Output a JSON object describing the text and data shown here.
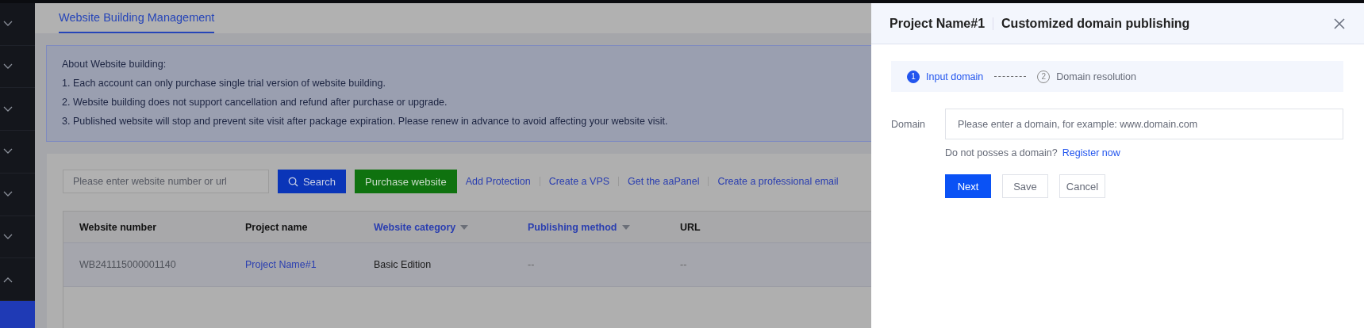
{
  "sidebar": {
    "items": [
      {
        "expanded": false
      },
      {
        "expanded": false
      },
      {
        "expanded": false
      },
      {
        "expanded": false
      },
      {
        "expanded": false
      },
      {
        "expanded": false
      },
      {
        "expanded": true,
        "children": [
          {
            "selected": true
          }
        ]
      }
    ]
  },
  "tabs": [
    {
      "label": "Website Building Management",
      "selected": true
    }
  ],
  "notice": {
    "title": "About Website building:",
    "lines": [
      "1. Each account can only purchase single trial version of website building.",
      "2. Website building does not support cancellation and refund after purchase or upgrade.",
      "3. Published website will stop and prevent site visit after package expiration. Please renew in advance to avoid affecting your website visit."
    ]
  },
  "toolbar": {
    "search": {
      "placeholder": "Please enter website number or url"
    },
    "search_button": "Search",
    "purchase_button": "Purchase website",
    "links": [
      "Add Protection",
      "Create a VPS",
      "Get the aaPanel",
      "Create a professional email"
    ]
  },
  "table": {
    "columns": [
      {
        "label": "Website number",
        "filter": false
      },
      {
        "label": "Project name",
        "filter": false
      },
      {
        "label": "Website category",
        "filter": true
      },
      {
        "label": "Publishing method",
        "filter": true
      },
      {
        "label": "URL",
        "filter": false
      }
    ],
    "rows": [
      [
        {
          "kind": "id",
          "text": "WB241115000001140"
        },
        {
          "kind": "link",
          "text": "Project Name#1"
        },
        {
          "kind": "text",
          "text": "Basic Edition"
        },
        {
          "kind": "muted",
          "text": "--"
        },
        {
          "kind": "muted",
          "text": "--"
        }
      ]
    ]
  },
  "drawer": {
    "project": "Project Name#1",
    "title": "Customized domain publishing",
    "steps": [
      {
        "number": "1",
        "label": "Input domain",
        "active": true
      },
      {
        "number": "2",
        "label": "Domain resolution",
        "active": false
      }
    ],
    "domain": {
      "label": "Domain",
      "placeholder": "Please enter a domain, for example: www.domain.com"
    },
    "hint": "Do not posses a domain?",
    "register_link": "Register now",
    "buttons": [
      {
        "kind": "primary",
        "label": "Next"
      },
      {
        "kind": "default",
        "label": "Save"
      },
      {
        "kind": "default",
        "label": "Cancel"
      }
    ]
  }
}
